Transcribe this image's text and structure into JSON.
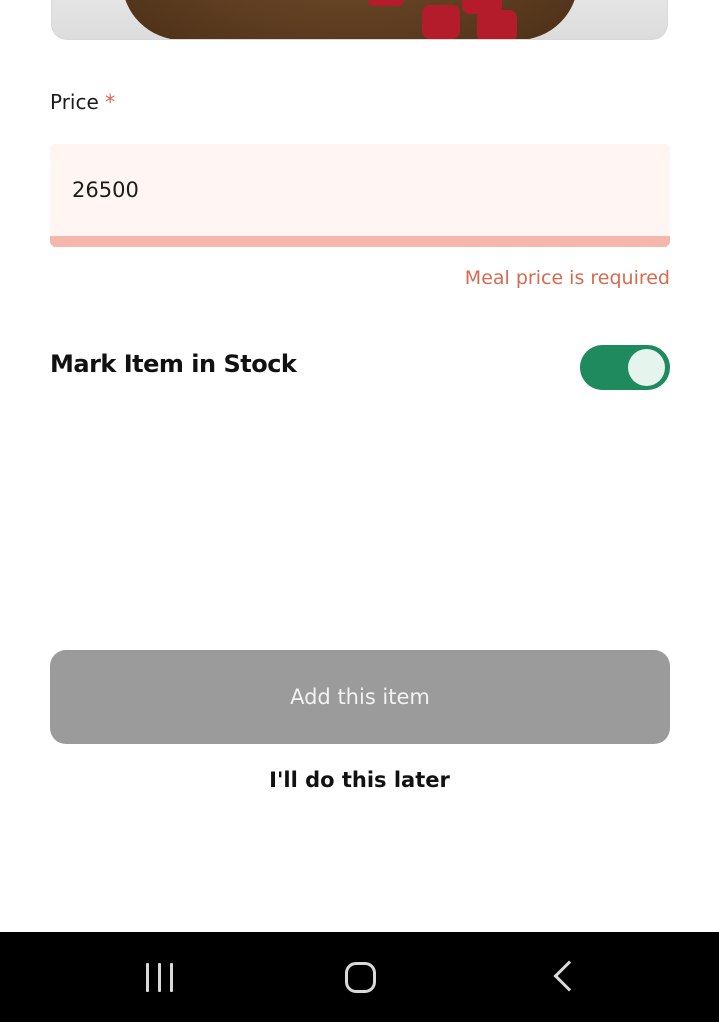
{
  "form": {
    "price_label": "Price",
    "required_marker": "*",
    "price_value": "26500",
    "price_error": "Meal price is required",
    "stock_label": "Mark Item in Stock",
    "stock_enabled": true
  },
  "actions": {
    "add_label": "Add this item",
    "later_label": "I'll do this later"
  },
  "colors": {
    "accent_green": "#1f8a5e",
    "error": "#d9694f",
    "input_bg": "#fff5f2",
    "disabled_button": "#9b9b9b"
  },
  "navbar": {
    "icons": [
      "recents-icon",
      "home-icon",
      "back-icon"
    ]
  }
}
